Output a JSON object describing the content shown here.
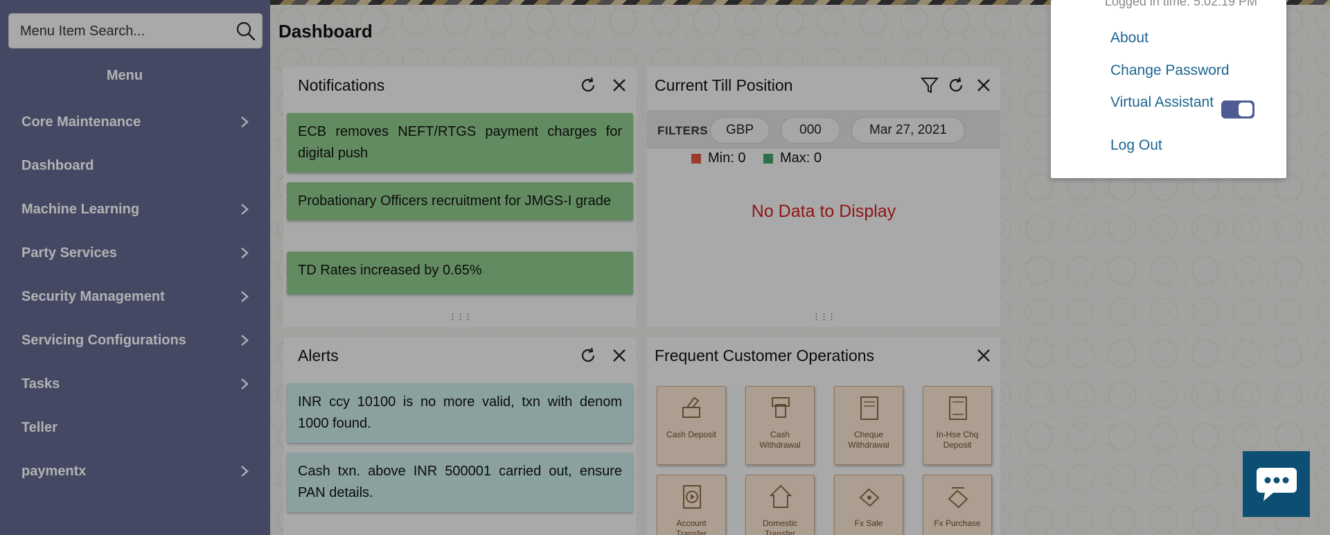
{
  "search": {
    "placeholder": "Menu Item Search..."
  },
  "sidebar": {
    "title": "Menu",
    "items": [
      {
        "label": "Core Maintenance",
        "has_submenu": true
      },
      {
        "label": "Dashboard",
        "has_submenu": false
      },
      {
        "label": "Machine Learning",
        "has_submenu": true
      },
      {
        "label": "Party Services",
        "has_submenu": true
      },
      {
        "label": "Security Management",
        "has_submenu": true
      },
      {
        "label": "Servicing Configurations",
        "has_submenu": true
      },
      {
        "label": "Tasks",
        "has_submenu": true
      },
      {
        "label": "Teller",
        "has_submenu": false
      },
      {
        "label": "paymentx",
        "has_submenu": true
      }
    ]
  },
  "header": {
    "title": "Dashboard"
  },
  "notifications": {
    "title": "Notifications",
    "items": [
      "ECB removes NEFT/RTGS payment charges for digital push",
      "Probationary Officers recruitment for JMGS-I grade",
      "TD Rates increased by 0.65%"
    ]
  },
  "till": {
    "title": "Current Till Position",
    "filters_label": "FILTERS",
    "filters": [
      "GBP",
      "000",
      "Mar 27, 2021"
    ],
    "legend_min": "Min: 0",
    "legend_max": "Max: 0",
    "no_data": "No Data to Display"
  },
  "alerts": {
    "title": "Alerts",
    "items": [
      "INR ccy 10100 is no more valid, txn with denom 1000 found.",
      "Cash txn. above INR 500001 carried out, ensure PAN details."
    ]
  },
  "operations": {
    "title": "Frequent Customer Operations",
    "tiles": [
      {
        "label": "Cash Deposit",
        "icon": "cash-deposit-icon"
      },
      {
        "label": "Cash Withdrawal",
        "icon": "cash-withdrawal-icon"
      },
      {
        "label": "Cheque Withdrawal",
        "icon": "cheque-withdrawal-icon"
      },
      {
        "label": "In-Hse Chq Deposit",
        "icon": "inhouse-cheque-deposit-icon"
      },
      {
        "label": "Account Transfer",
        "icon": "account-transfer-icon"
      },
      {
        "label": "Domestic Transfer",
        "icon": "domestic-transfer-icon"
      },
      {
        "label": "Fx Sale",
        "icon": "fx-sale-icon"
      },
      {
        "label": "Fx Purchase",
        "icon": "fx-purchase-icon"
      }
    ]
  },
  "user_menu": {
    "logged_in_time": "Logged in time: 5:02:19 PM",
    "about": "About",
    "change_password": "Change Password",
    "virtual_assistant": "Virtual Assistant",
    "virtual_assistant_enabled": true,
    "log_out": "Log Out"
  },
  "colors": {
    "sidebar": "#62678e",
    "notification": "#8fc78c",
    "alert": "#c6e7e6",
    "link": "#1b6590",
    "no_data": "#cc1f1f",
    "min_legend": "#e0533f",
    "max_legend": "#3fa26a"
  }
}
